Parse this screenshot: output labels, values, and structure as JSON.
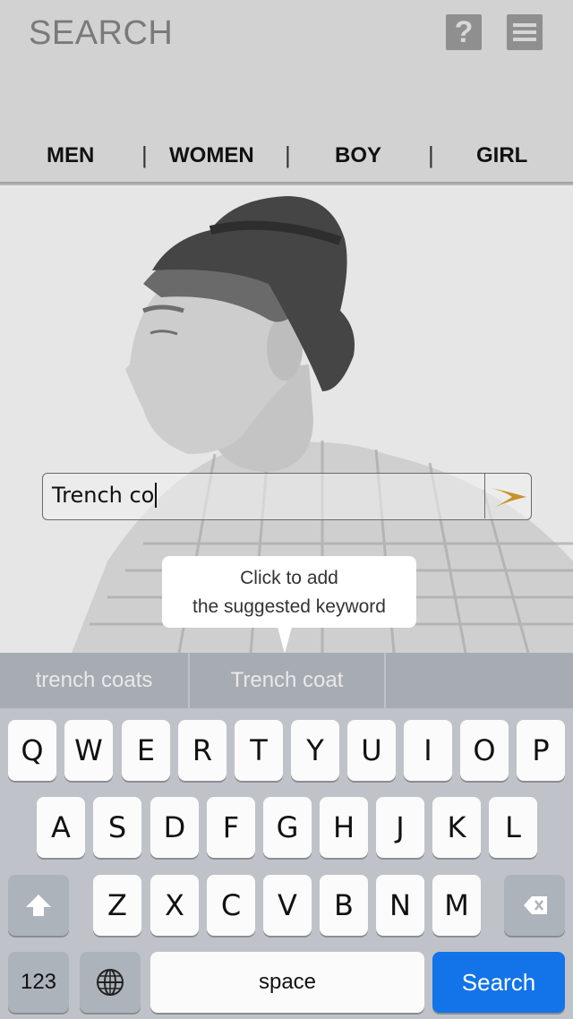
{
  "header": {
    "title": "SEARCH",
    "help_label": "?",
    "categories": [
      "MEN",
      "WOMEN",
      "BOY",
      "GIRL"
    ],
    "separator": "|"
  },
  "search": {
    "value": "Trench co"
  },
  "tooltip": {
    "line1": "Click to add",
    "line2": "the suggested keyword"
  },
  "suggestions": [
    "trench coats",
    "Trench coat",
    ""
  ],
  "keyboard": {
    "row1": [
      "Q",
      "W",
      "E",
      "R",
      "T",
      "Y",
      "U",
      "I",
      "O",
      "P"
    ],
    "row2": [
      "A",
      "S",
      "D",
      "F",
      "G",
      "H",
      "J",
      "K",
      "L"
    ],
    "row3": [
      "Z",
      "X",
      "C",
      "V",
      "B",
      "N",
      "M"
    ],
    "numbers_label": "123",
    "space_label": "space",
    "search_label": "Search",
    "shift_icon": "shift-arrow-icon",
    "delete_icon": "backspace-icon",
    "globe_icon": "globe-icon"
  },
  "colors": {
    "search_key": "#1274e8",
    "arrow_gold": "#c9922a"
  }
}
